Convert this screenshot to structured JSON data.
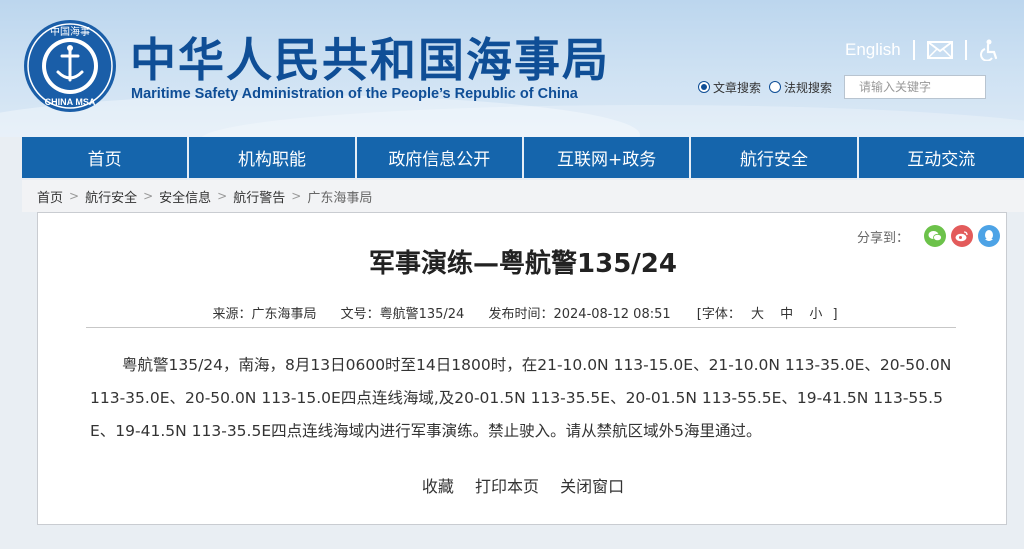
{
  "header": {
    "title": "中华人民共和国海事局",
    "subtitle": "Maritime Safety Administration of the People’s Republic of China",
    "logo_icon": "msa-emblem-icon",
    "logo_text_top": "中国海事",
    "logo_text_bottom": "CHINA MSA",
    "links": {
      "english": "English",
      "mail_icon": "mail-icon",
      "accessibility_icon": "accessibility-icon"
    },
    "search": {
      "option_article": "文章搜索",
      "option_law": "法规搜索",
      "selected": "文章搜索",
      "placeholder": "请输入关键字"
    }
  },
  "nav": {
    "items": [
      "首页",
      "机构职能",
      "政府信息公开",
      "互联网+政务",
      "航行安全",
      "互动交流"
    ]
  },
  "breadcrumb": {
    "items": [
      "首页",
      "航行安全",
      "安全信息",
      "航行警告",
      "广东海事局"
    ],
    "separator": ">"
  },
  "article": {
    "share_label": "分享到：",
    "share_buttons": [
      "wechat-icon",
      "weibo-icon",
      "qq-icon"
    ],
    "title": "军事演练—粤航警135/24",
    "meta": {
      "source": "来源：广东海事局",
      "doc_no": "文号：粤航警135/24",
      "publish_time": "发布时间：2024-08-12 08:51",
      "font_label": "[字体：",
      "font_large": "大",
      "font_medium": "中",
      "font_small": "小",
      "font_end": "]"
    },
    "body": "粤航警135/24，南海，8月13日0600时至14日1800时，在21-10.0N 113-15.0E、21-10.0N 113-35.0E、20-50.0N 113-35.0E、20-50.0N 113-15.0E四点连线海域,及20-01.5N 113-35.5E、20-01.5N 113-55.5E、19-41.5N 113-55.5E、19-41.5N 113-35.5E四点连线海域内进行军事演练。禁止驶入。请从禁航区域外5海里通过。",
    "actions": {
      "favorite": "收藏",
      "print": "打印本页",
      "close": "关闭窗口"
    }
  },
  "colors": {
    "brand_blue": "#0f4e96",
    "nav_blue": "#1565ac",
    "header_bg": "#cfe2f3"
  }
}
